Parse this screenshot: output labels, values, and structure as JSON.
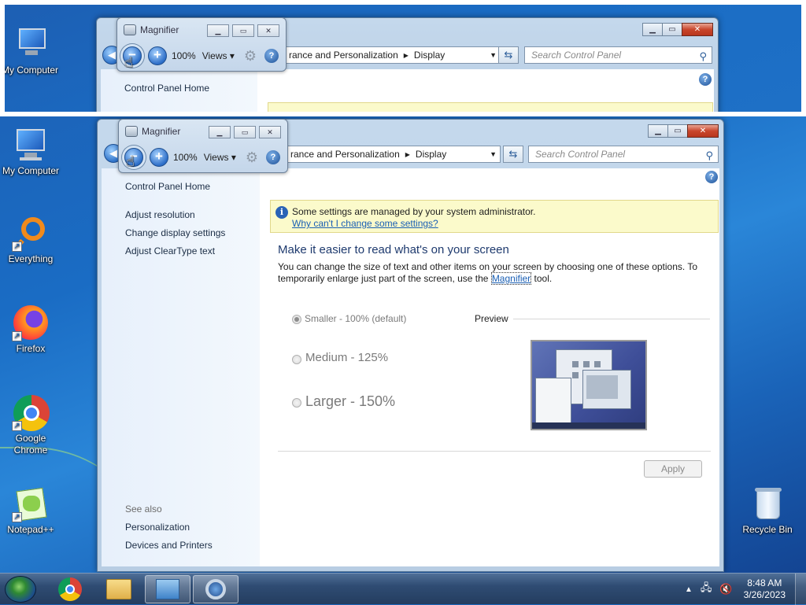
{
  "desktop": {
    "icons": [
      {
        "label": "My Computer"
      },
      {
        "label": "Everything"
      },
      {
        "label": "Firefox"
      },
      {
        "label": "Google Chrome"
      },
      {
        "label": "Notepad++"
      },
      {
        "label": "Recycle Bin"
      }
    ]
  },
  "magnifier": {
    "title": "Magnifier",
    "zoom_out": "−",
    "zoom_in": "+",
    "zoom_level": "100%",
    "views_label": "Views",
    "views_arrow": "▾",
    "help": "?"
  },
  "window": {
    "breadcrumb_visible": "rance and Personalization",
    "breadcrumb_current": "Display",
    "search_placeholder": "Search Control Panel",
    "sidebar": {
      "home": "Control Panel Home",
      "links": [
        "Adjust resolution",
        "Change display settings",
        "Adjust ClearType text"
      ],
      "see_also_title": "See also",
      "see_also": [
        "Personalization",
        "Devices and Printers"
      ]
    },
    "info_bar": {
      "message": "Some settings are managed by your system administrator.",
      "link": "Why can't I change some settings?"
    },
    "heading": "Make it easier to read what's on your screen",
    "description_before": "You can change the size of text and other items on your screen by choosing one of these options. To temporarily enlarge just part of the screen, use the ",
    "description_link": "Magnifier",
    "description_after": " tool.",
    "options": [
      {
        "label": "Smaller - 100% (default)",
        "selected": true
      },
      {
        "label": "Medium - 125%",
        "selected": false
      },
      {
        "label": "Larger - 150%",
        "selected": false
      }
    ],
    "preview_label": "Preview",
    "apply_label": "Apply"
  },
  "taskbar": {
    "time": "8:48 AM",
    "date": "3/26/2023",
    "pinned": [
      "explorer",
      "chrome",
      "control-panel",
      "magnifier"
    ]
  },
  "colors": {
    "link": "#1a5fb4",
    "heading": "#1e3a6e",
    "info_bg": "#fbfacb",
    "close_red": "#c9462c"
  }
}
